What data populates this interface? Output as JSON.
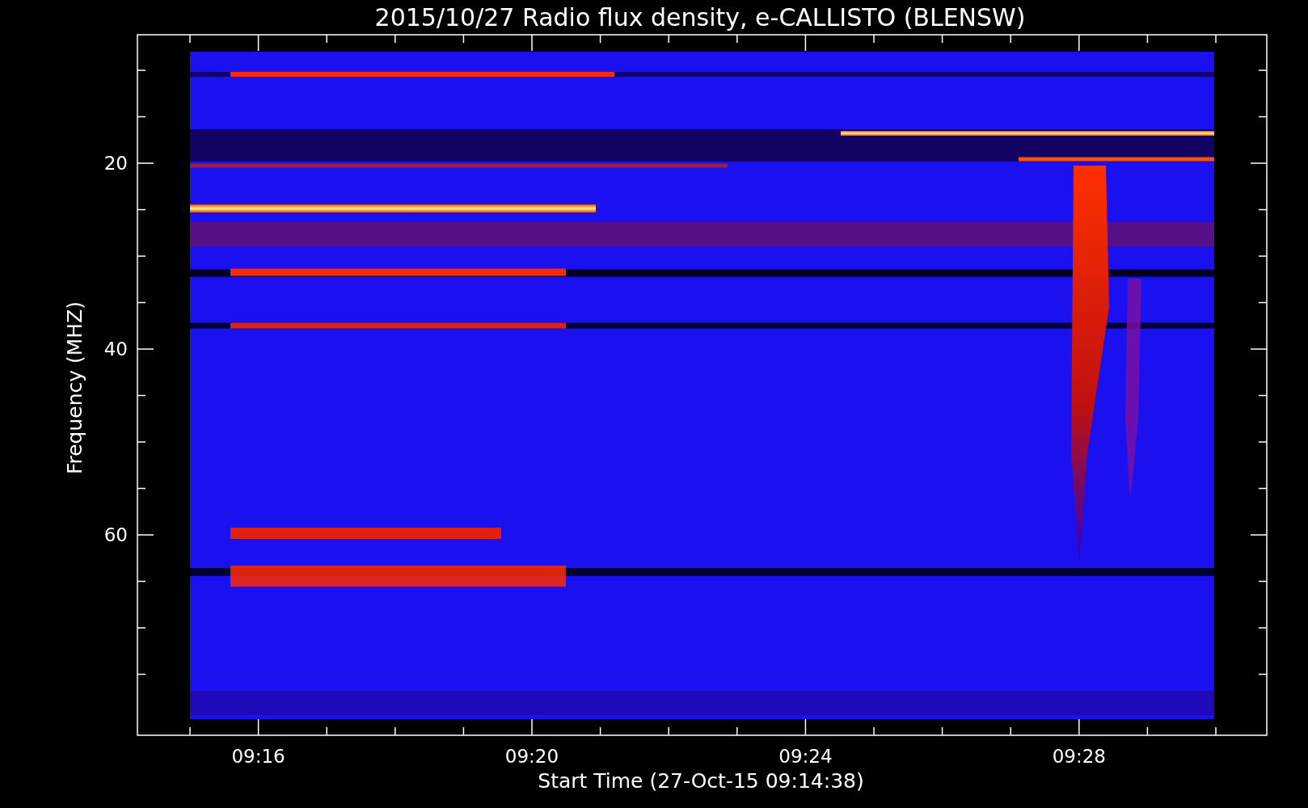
{
  "title": "2015/10/27  Radio flux density, e-CALLISTO (BLENSW)",
  "y_axis": {
    "label": "Frequency (MHZ)",
    "ticks": [
      "20",
      "40",
      "60"
    ]
  },
  "x_axis": {
    "label": "Start Time (27-Oct-15 09:14:38)",
    "ticks": [
      "09:16",
      "09:20",
      "09:24",
      "09:28"
    ]
  }
}
